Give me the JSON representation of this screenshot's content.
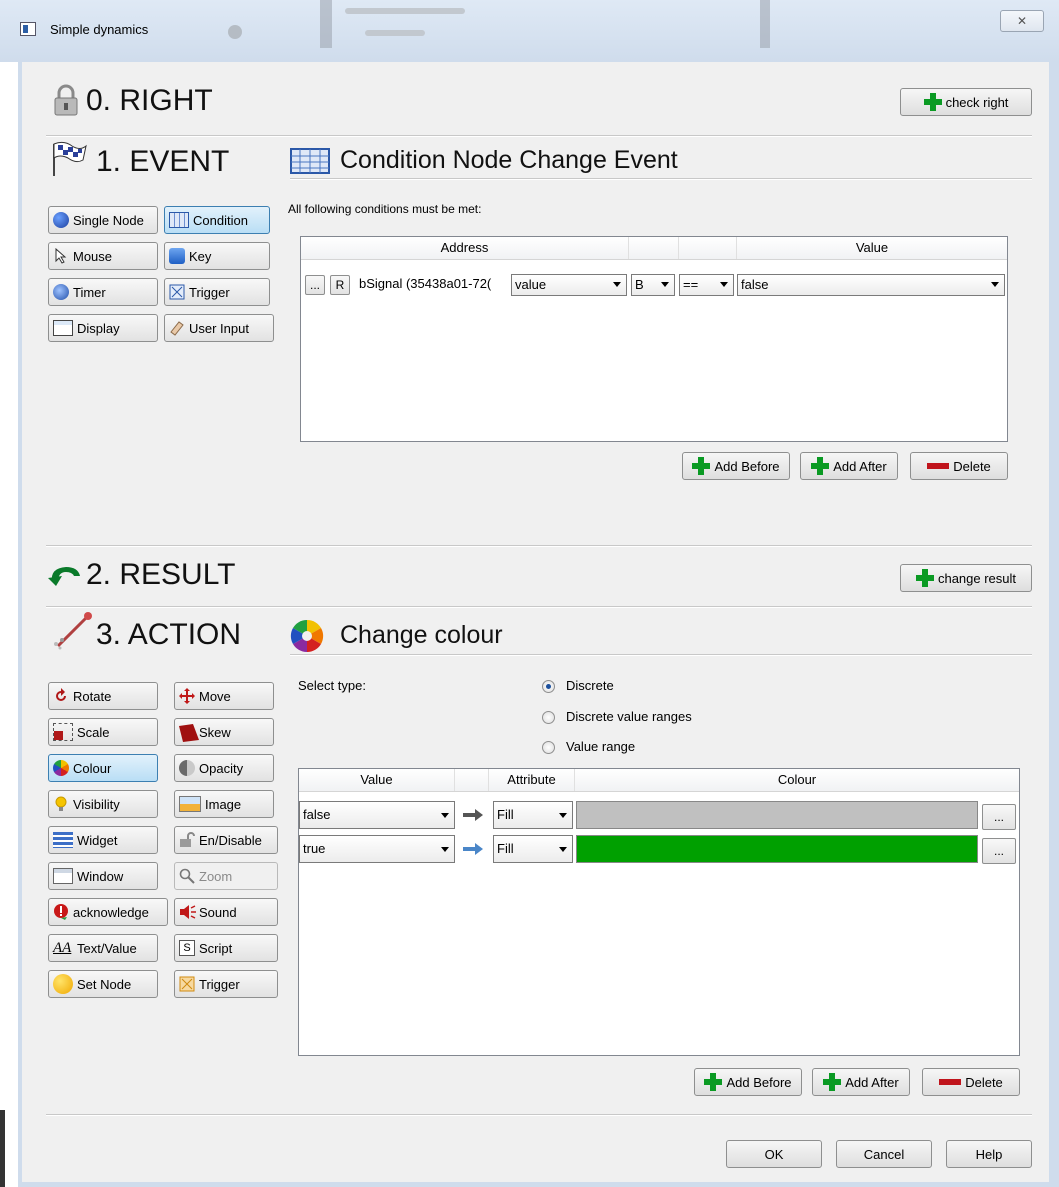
{
  "window": {
    "title": "Simple dynamics",
    "close_label": "✕"
  },
  "right": {
    "heading": "0. RIGHT",
    "button": "check right"
  },
  "event": {
    "heading": "1. EVENT",
    "subtitle": "Condition Node Change Event",
    "buttons": [
      "Single Node",
      "Condition",
      "Mouse",
      "Key",
      "Timer",
      "Trigger",
      "Display",
      "User Input"
    ],
    "instruction": "All following conditions must be met:",
    "columns": [
      "Address",
      "Value"
    ],
    "row": {
      "dots": "...",
      "r": "R",
      "address": "bSignal (35438a01-72(",
      "field": "value",
      "type": "B",
      "op": "==",
      "value": "false"
    },
    "add_before": "Add Before",
    "add_after": "Add After",
    "delete": "Delete"
  },
  "result": {
    "heading": "2. RESULT",
    "button": "change result"
  },
  "action": {
    "heading": "3. ACTION",
    "subtitle": "Change colour",
    "buttons": [
      "Rotate",
      "Move",
      "Scale",
      "Skew",
      "Colour",
      "Opacity",
      "Visibility",
      "Image",
      "Widget",
      "En/Disable",
      "Window",
      "Zoom",
      "acknowledge",
      "Sound",
      "Text/Value",
      "Script",
      "Set Node",
      "Trigger"
    ],
    "select_type_label": "Select type:",
    "types": [
      "Discrete",
      "Discrete value ranges",
      "Value range"
    ],
    "columns": [
      "Value",
      "Attribute",
      "Colour"
    ],
    "rows": [
      {
        "value": "false",
        "attribute": "Fill",
        "colour": "#c0c0c0",
        "dots": "..."
      },
      {
        "value": "true",
        "attribute": "Fill",
        "colour": "#00a000",
        "dots": "..."
      }
    ],
    "add_before": "Add Before",
    "add_after": "Add After",
    "delete": "Delete"
  },
  "footer": {
    "ok": "OK",
    "cancel": "Cancel",
    "help": "Help"
  }
}
